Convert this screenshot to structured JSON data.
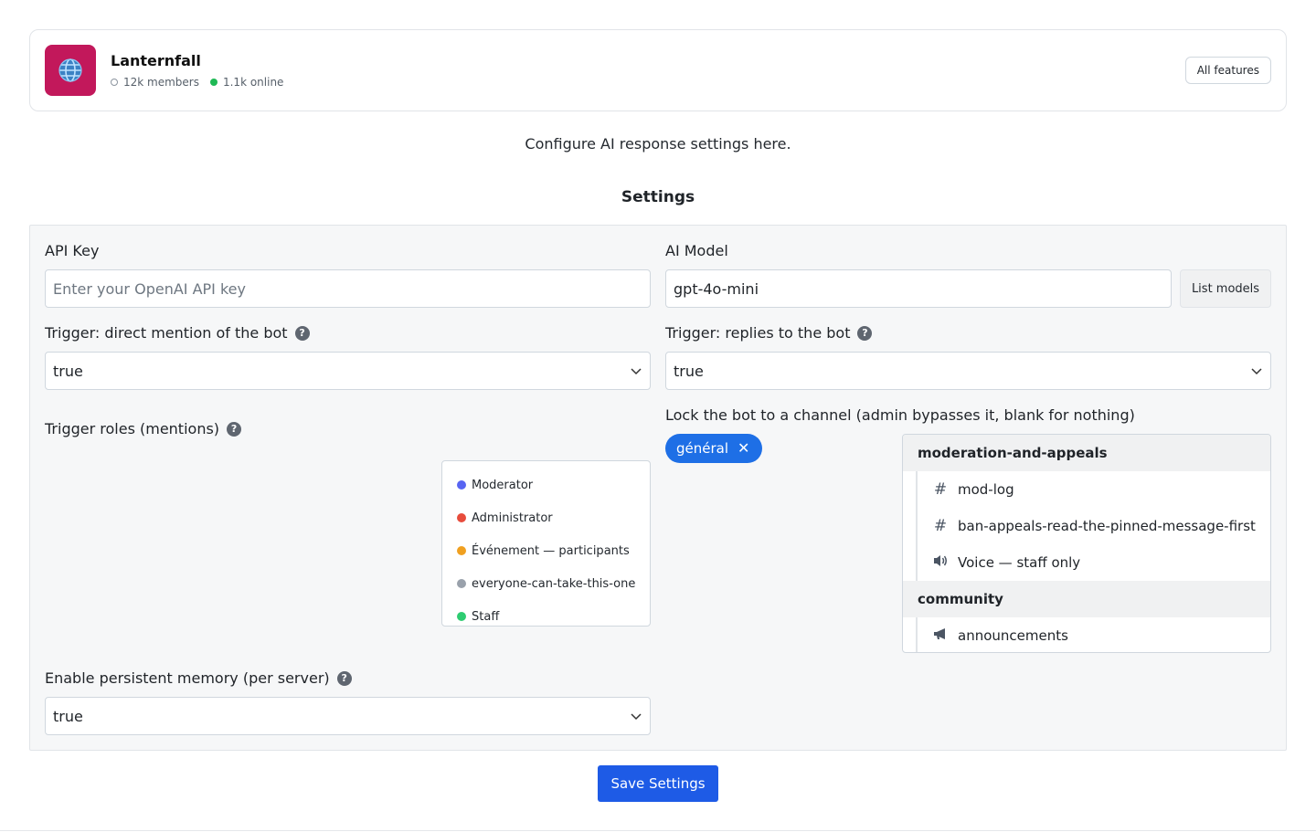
{
  "server": {
    "name": "Lanternfall",
    "members": "12k members",
    "online": "1.1k online",
    "icon": "globe-icon",
    "icon_color": "#c2185b",
    "all_features_label": "All features"
  },
  "intro": "Configure AI response settings here.",
  "settings_title": "Settings",
  "api_key": {
    "label": "API Key",
    "placeholder": "Enter your OpenAI API key",
    "value": ""
  },
  "ai_model": {
    "label": "AI Model",
    "value": "gpt-4o-mini",
    "list_models_label": "List models"
  },
  "trigger_mention": {
    "label": "Trigger: direct mention of the bot",
    "value": "true"
  },
  "trigger_replies": {
    "label": "Trigger: replies to the bot",
    "value": "true"
  },
  "trigger_roles": {
    "label": "Trigger roles (mentions)",
    "roles": [
      {
        "name": "Moderator",
        "color": "#5865f2"
      },
      {
        "name": "Administrator",
        "color": "#e74c3c"
      },
      {
        "name": "Événement — participants",
        "color": "#f0a020"
      },
      {
        "name": "everyone-can-take-this-one",
        "color": "#99a1ab"
      },
      {
        "name": "Staff",
        "color": "#2ecc71"
      }
    ]
  },
  "lock_channel": {
    "label": "Lock the bot to a channel (admin bypasses it, blank for nothing)",
    "selected_chip": "général",
    "categories": [
      {
        "name": "moderation-and-appeals",
        "channels": [
          {
            "name": "mod-log",
            "icon": "hash-icon"
          },
          {
            "name": "ban-appeals-read-the-pinned-message-first",
            "icon": "hash-icon"
          },
          {
            "name": "Voice — staff only",
            "icon": "speaker-icon"
          }
        ]
      },
      {
        "name": "community",
        "channels": [
          {
            "name": "announcements",
            "icon": "megaphone-icon"
          }
        ]
      }
    ]
  },
  "persistent_memory": {
    "label": "Enable persistent memory (per server)",
    "value": "true"
  },
  "save_label": "Save Settings",
  "colors": {
    "accent": "#1e5be6",
    "chip": "#1e6fe6"
  }
}
